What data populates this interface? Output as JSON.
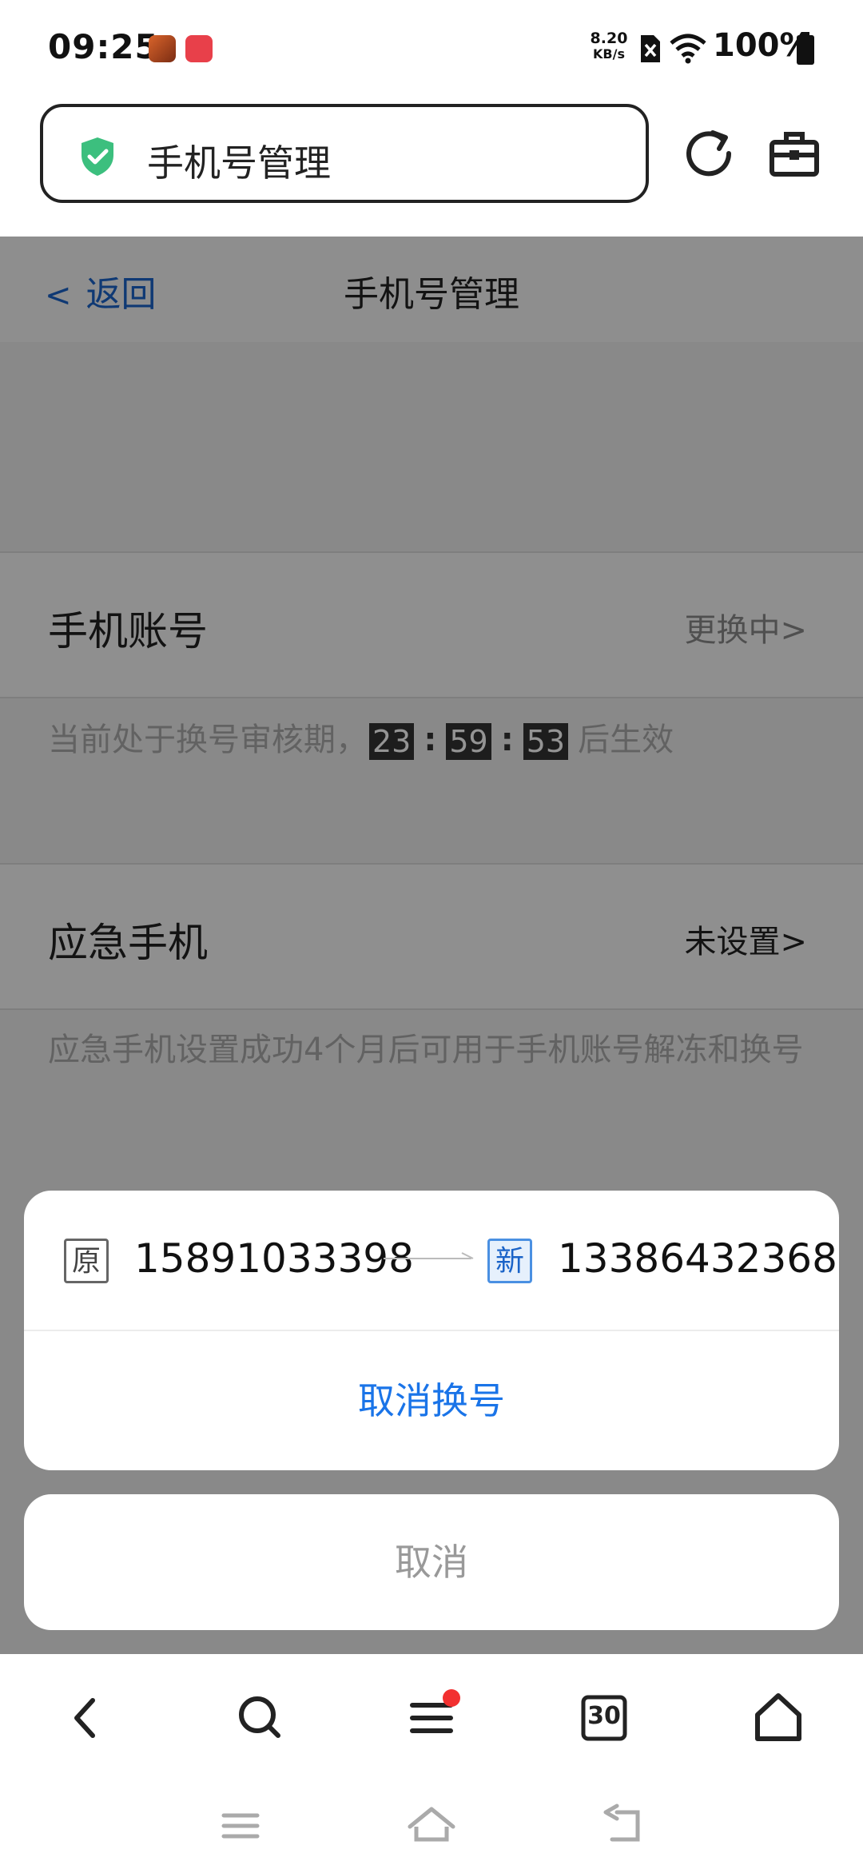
{
  "status_bar": {
    "time": "09:25",
    "net_speed_value": "8.20",
    "net_speed_unit": "KB/s",
    "battery": "100%",
    "app_icons": [
      "game-app-icon",
      "huawei-app-icon"
    ]
  },
  "browser": {
    "url_title": "手机号管理",
    "icons": [
      "shield-check-icon",
      "refresh-icon",
      "toolbox-icon"
    ]
  },
  "page": {
    "back_label": "返回",
    "title": "手机号管理",
    "phone_account": {
      "label": "手机账号",
      "status": "更换中>",
      "hint_prefix": "当前处于换号审核期，",
      "countdown": {
        "hours": "23",
        "minutes": "59",
        "seconds": "53"
      },
      "hint_suffix": "后生效"
    },
    "emergency_phone": {
      "label": "应急手机",
      "status": "未设置>",
      "hint": "应急手机设置成功4个月后可用于手机账号解冻和换号"
    }
  },
  "sheet": {
    "old_tag": "原",
    "old_number": "15891033398",
    "new_tag": "新",
    "new_number": "13386432368",
    "cancel_change_label": "取消换号",
    "cancel_label": "取消"
  },
  "toolbar": {
    "tabs_count": "30",
    "icons": [
      "back-icon",
      "search-icon",
      "menu-icon",
      "tabs-icon",
      "home-icon"
    ]
  },
  "colors": {
    "link_blue": "#1a63c8",
    "action_blue": "#1a74e8",
    "shield_green": "#3cbf7e",
    "notify_red": "#f23030"
  }
}
